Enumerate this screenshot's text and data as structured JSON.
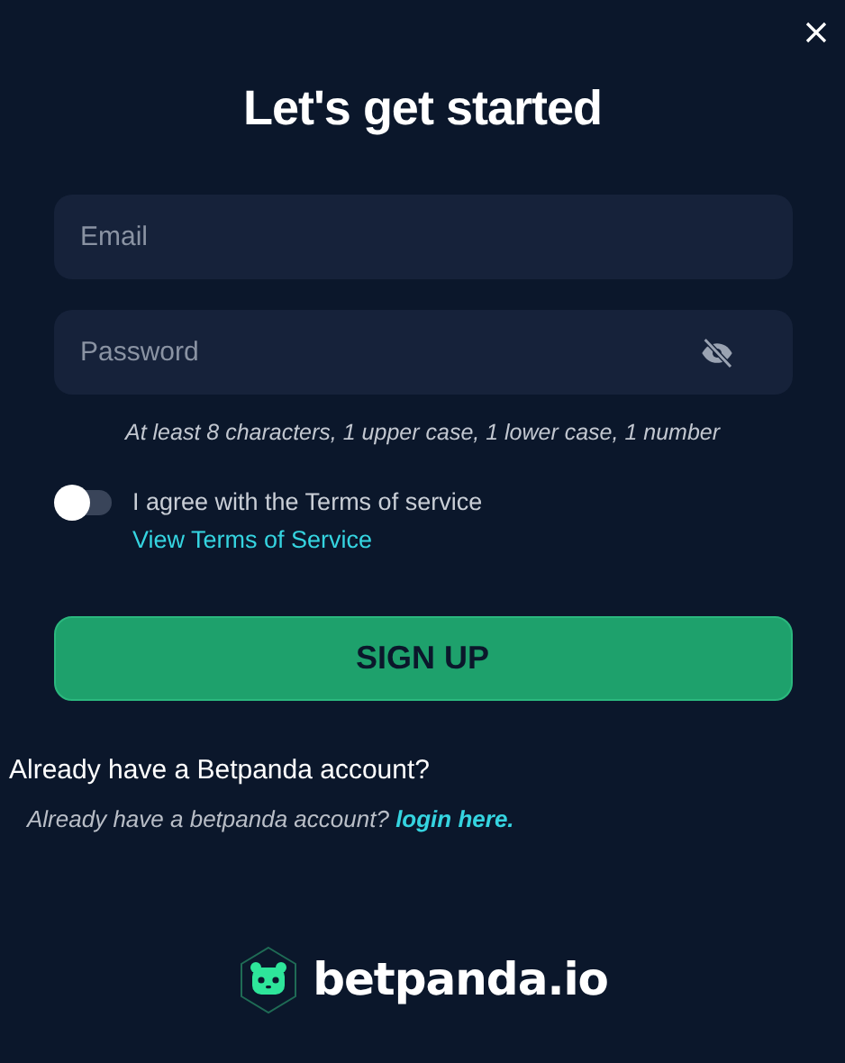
{
  "title": "Let's get started",
  "email": {
    "placeholder": "Email"
  },
  "password": {
    "placeholder": "Password",
    "hint": "At least 8 characters, 1 upper case, 1 lower case, 1 number"
  },
  "terms": {
    "on": false,
    "text": "I agree with the Terms of service",
    "link": "View Terms of Service"
  },
  "submit": "SIGN UP",
  "login": {
    "heading": "Already have a Betpanda account?",
    "text": "Already have a betpanda account?",
    "link": "login here."
  },
  "logo": "betpanda.io"
}
